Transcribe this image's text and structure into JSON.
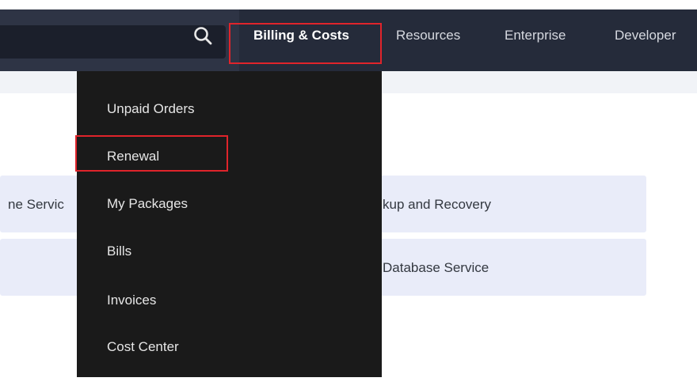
{
  "nav": {
    "items": [
      {
        "label": "Billing & Costs"
      },
      {
        "label": "Resources"
      },
      {
        "label": "Enterprise"
      },
      {
        "label": "Developer"
      }
    ]
  },
  "search": {
    "icon": "search-icon"
  },
  "dropdown": {
    "items": [
      {
        "label": "Unpaid Orders"
      },
      {
        "label": "Renewal"
      },
      {
        "label": "My Packages"
      },
      {
        "label": "Bills"
      },
      {
        "label": "Invoices"
      },
      {
        "label": "Cost Center"
      }
    ]
  },
  "cards": [
    {
      "left_text": "ne Servic",
      "right_text": "kup and Recovery"
    },
    {
      "left_text": "",
      "right_text": "Database Service"
    }
  ],
  "colors": {
    "highlight": "#e0242b",
    "topbar": "#252b3a",
    "dropdown": "#1a1a1a",
    "card": "#e9ecf9"
  }
}
